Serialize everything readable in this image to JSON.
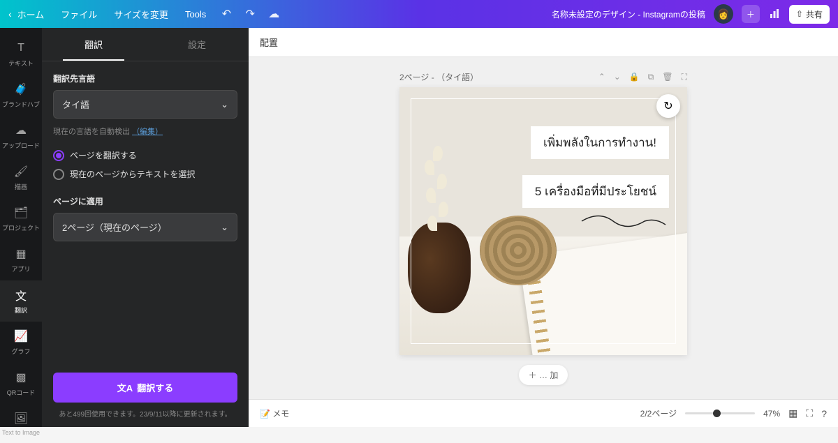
{
  "topbar": {
    "home": "ホーム",
    "file": "ファイル",
    "resize": "サイズを変更",
    "tools": "Tools",
    "title": "名称未設定のデザイン - Instagramの投稿",
    "share": "共有"
  },
  "rail": {
    "items": [
      {
        "label": "テキスト",
        "icon": "T"
      },
      {
        "label": "ブランドハブ",
        "icon": "briefcase"
      },
      {
        "label": "アップロード",
        "icon": "cloud"
      },
      {
        "label": "描画",
        "icon": "brush"
      },
      {
        "label": "プロジェクト",
        "icon": "folder"
      },
      {
        "label": "アプリ",
        "icon": "grid"
      },
      {
        "label": "翻訳",
        "icon": "translate",
        "active": true
      },
      {
        "label": "グラフ",
        "icon": "chart"
      },
      {
        "label": "QRコード",
        "icon": "qr"
      },
      {
        "label": "Text to Image",
        "icon": "image"
      }
    ]
  },
  "panel": {
    "tabs": {
      "translate": "翻訳",
      "settings": "設定"
    },
    "target_lang_label": "翻訳先言語",
    "target_lang_value": "タイ語",
    "detect_hint": "現在の言語を自動検出",
    "detect_edit": "（編集）",
    "radio1": "ページを翻訳する",
    "radio2": "現在のページからテキストを選択",
    "apply_label": "ページに適用",
    "apply_value": "2ページ（現在のページ）",
    "translate_btn": "翻訳する",
    "usage": "あと499回使用できます。23/9/11以降に更新されます。"
  },
  "context": {
    "placement": "配置"
  },
  "page": {
    "header": "2ページ - （タイ語）",
    "text1": "เพิ่มพลังในการทำงาน!",
    "text2": "5 เครื่องมือที่มีประโยชน์",
    "add": "＋ … 加"
  },
  "bottom": {
    "memo": "メモ",
    "pager": "2/2ページ",
    "zoom": "47%"
  }
}
